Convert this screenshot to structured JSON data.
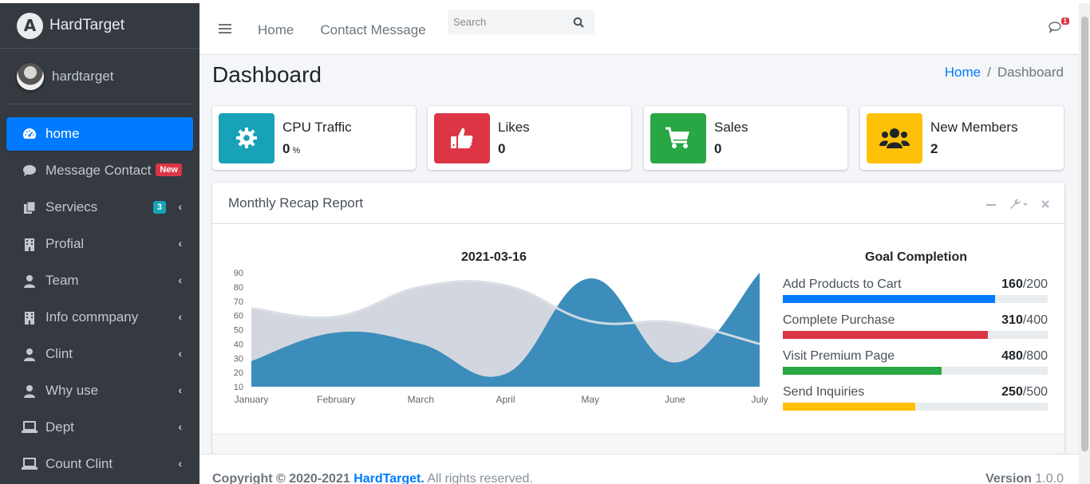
{
  "brand": {
    "name": "HardTarget",
    "logo_letter": "A"
  },
  "user": {
    "name": "hardtarget"
  },
  "sidebar": {
    "items": [
      {
        "label": "home",
        "icon": "tachometer-icon",
        "active": true
      },
      {
        "label": "Message Contact",
        "icon": "comment-icon",
        "badge": "New"
      },
      {
        "label": "Serviecs",
        "icon": "copy-icon",
        "badge": "3"
      },
      {
        "label": "Profial",
        "icon": "building-icon"
      },
      {
        "label": "Team",
        "icon": "user-icon"
      },
      {
        "label": "Info commpany",
        "icon": "building-icon"
      },
      {
        "label": "Clint",
        "icon": "user-icon"
      },
      {
        "label": "Why use",
        "icon": "user-icon"
      },
      {
        "label": "Dept",
        "icon": "laptop-icon"
      },
      {
        "label": "Count Clint",
        "icon": "laptop-icon"
      }
    ]
  },
  "navbar": {
    "links": [
      "Home",
      "Contact Message"
    ],
    "search_placeholder": "Search",
    "chat_badge": "1"
  },
  "page": {
    "title": "Dashboard"
  },
  "breadcrumb": {
    "home": "Home",
    "separator": "/",
    "current": "Dashboard"
  },
  "info_boxes": [
    {
      "label": "CPU Traffic",
      "value": "0",
      "unit": "%",
      "color": "#17a2b8",
      "icon": "gear-icon"
    },
    {
      "label": "Likes",
      "value": "0",
      "color": "#dc3545",
      "icon": "thumbs-up-icon"
    },
    {
      "label": "Sales",
      "value": "0",
      "color": "#28a745",
      "icon": "shopping-cart-icon"
    },
    {
      "label": "New Members",
      "value": "2",
      "color": "#ffc107",
      "icon": "users-icon"
    }
  ],
  "card": {
    "title": "Monthly Recap Report"
  },
  "chart_data": {
    "type": "area",
    "title": "2021-03-16",
    "categories": [
      "January",
      "February",
      "March",
      "April",
      "May",
      "June",
      "July"
    ],
    "ylim": [
      10,
      90
    ],
    "yticks": [
      10,
      20,
      30,
      40,
      50,
      60,
      70,
      80,
      90
    ],
    "series": [
      {
        "values": [
          65,
          59,
          80,
          81,
          56,
          55,
          40
        ],
        "color": "#d2d6de"
      },
      {
        "values": [
          28,
          48,
          40,
          19,
          86,
          27,
          90
        ],
        "color": "#3c8dbc"
      }
    ]
  },
  "goals": {
    "title": "Goal Completion",
    "items": [
      {
        "label": "Add Products to Cart",
        "value": "160",
        "total": "/200",
        "fraction": 0.8,
        "color": "#007bff"
      },
      {
        "label": "Complete Purchase",
        "value": "310",
        "total": "/400",
        "fraction": 0.775,
        "color": "#dc3545"
      },
      {
        "label": "Visit Premium Page",
        "value": "480",
        "total": "/800",
        "fraction": 0.6,
        "color": "#28a745"
      },
      {
        "label": "Send Inquiries",
        "value": "250",
        "total": "/500",
        "fraction": 0.5,
        "color": "#ffc107"
      }
    ]
  },
  "footer": {
    "copyright": "Copyright © 2020-2021",
    "company": "HardTarget.",
    "rights": " All rights reserved.",
    "version_label": "Version",
    "version": "1.0.0"
  }
}
